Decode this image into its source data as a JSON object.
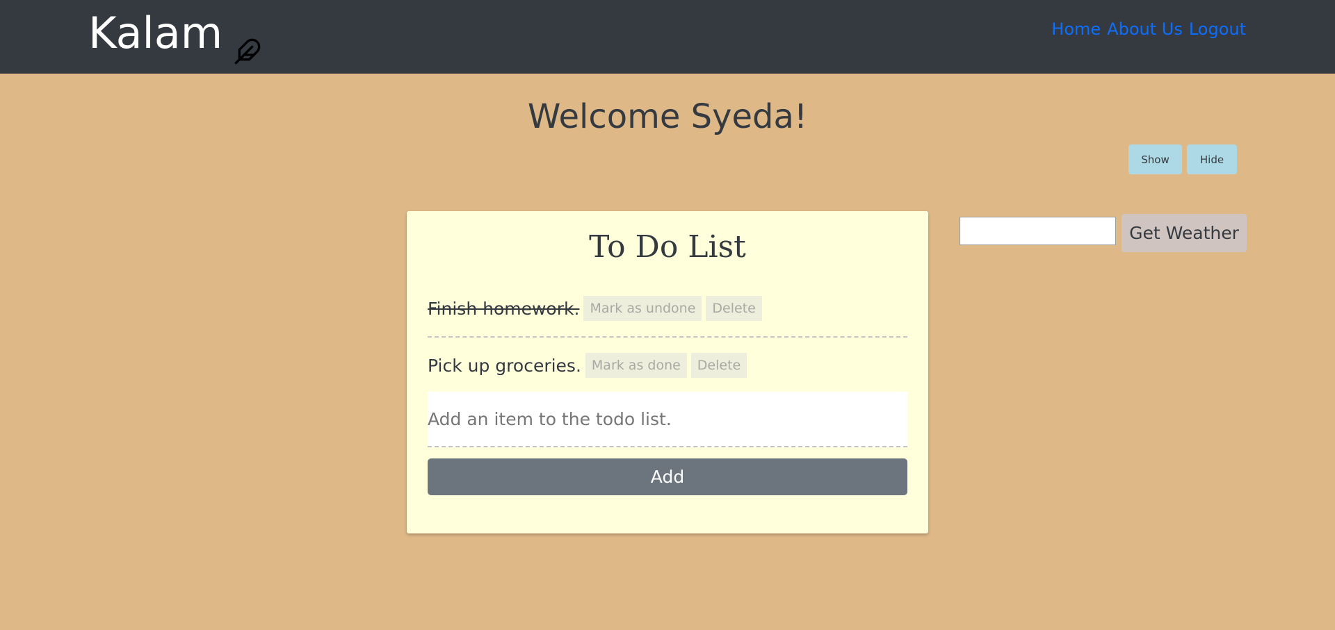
{
  "navbar": {
    "brand": "Kalam",
    "brand_icon": "feather-icon",
    "links": [
      "Home",
      "About Us",
      "Logout"
    ],
    "link_color": "#0d6efd",
    "background": "#343a40"
  },
  "welcome": "Welcome Syeda!",
  "toggles": {
    "show_label": "Show",
    "hide_label": "Hide"
  },
  "todo": {
    "title": "To Do List",
    "items": [
      {
        "text": "Finish homework.",
        "done": true,
        "toggle_label": "Mark as undone",
        "delete_label": "Delete"
      },
      {
        "text": "Pick up groceries.",
        "done": false,
        "toggle_label": "Mark as done",
        "delete_label": "Delete"
      }
    ],
    "input_placeholder": "Add an item to the todo list.",
    "add_label": "Add"
  },
  "weather": {
    "input_value": "",
    "button_label": "Get Weather"
  },
  "colors": {
    "page_background": "#deb887",
    "card_background": "#ffffdc",
    "toggle_button": "#add8e6"
  }
}
